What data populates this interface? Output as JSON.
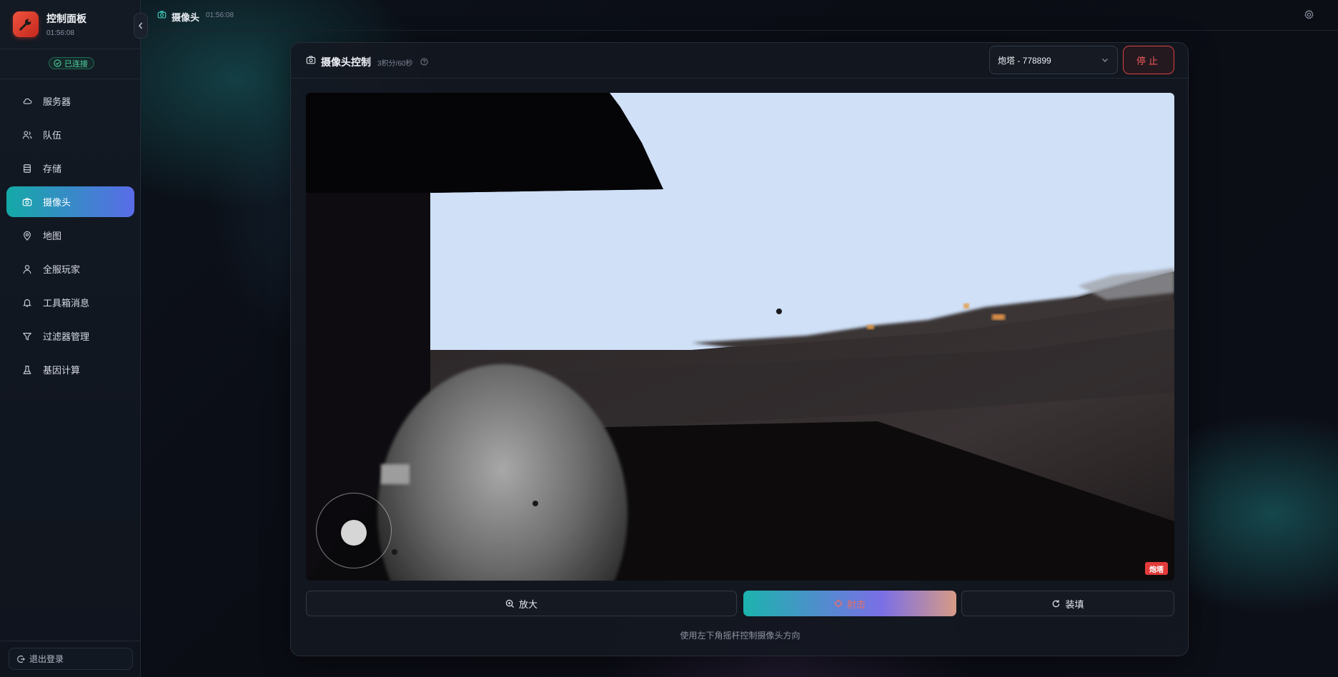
{
  "app": {
    "title": "控制面板",
    "time": "01:56:08",
    "status": "已连接"
  },
  "sidebar": {
    "items": [
      {
        "label": "服务器",
        "icon": "cloud-icon"
      },
      {
        "label": "队伍",
        "icon": "users-icon"
      },
      {
        "label": "存储",
        "icon": "storage-icon"
      },
      {
        "label": "摄像头",
        "icon": "camera-icon",
        "active": true
      },
      {
        "label": "地图",
        "icon": "map-pin-icon"
      },
      {
        "label": "全服玩家",
        "icon": "user-icon"
      },
      {
        "label": "工具箱消息",
        "icon": "bell-icon"
      },
      {
        "label": "过滤器管理",
        "icon": "filter-icon"
      },
      {
        "label": "基因计算",
        "icon": "flask-icon"
      }
    ],
    "logout_label": "退出登录"
  },
  "topbar": {
    "title": "摄像头",
    "time": "01:56:08"
  },
  "camera": {
    "title": "摄像头控制",
    "cost": "3积分/60秒",
    "selected_turret": "炮塔 - 778899",
    "stop_label": "停止",
    "feed_tag": "炮塔",
    "zoom_label": "放大",
    "fire_label": "射击",
    "reload_label": "装填",
    "hint": "使用左下角摇杆控制摄像头方向"
  },
  "colors": {
    "accent_teal": "#14a9a6",
    "accent_indigo": "#5a6ce8",
    "danger": "#e23b3b",
    "success": "#4fd3a0"
  }
}
